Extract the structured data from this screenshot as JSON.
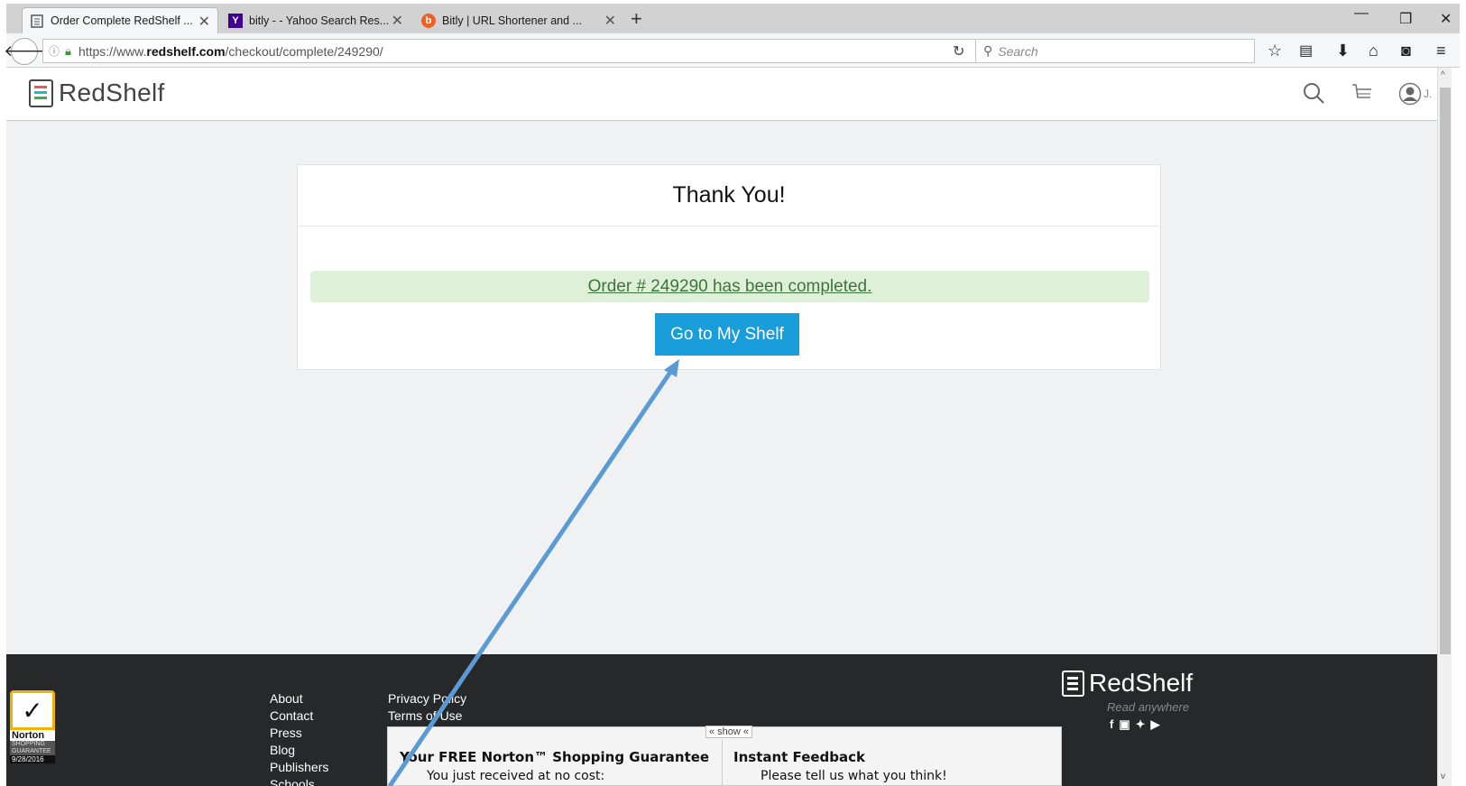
{
  "browser": {
    "tabs": [
      {
        "title": "Order Complete RedShelf ...",
        "icon": "page-icon"
      },
      {
        "title": "bitly - - Yahoo Search Res...",
        "icon": "yahoo-icon",
        "icon_text": "Y"
      },
      {
        "title": "Bitly | URL Shortener and ...",
        "icon": "bitly-icon",
        "icon_text": "b"
      }
    ],
    "url_prefix": "https://www.",
    "url_domain": "redshelf.com",
    "url_path": "/checkout/complete/249290/",
    "search_placeholder": "Search"
  },
  "header": {
    "logo_text": "RedShelf",
    "user_initial": "J."
  },
  "card": {
    "title": "Thank You!",
    "order_message": "Order # 249290 has been completed.",
    "button_label": "Go to My Shelf"
  },
  "footer": {
    "links_col1": [
      "About",
      "Contact",
      "Press",
      "Blog",
      "Publishers",
      "Schools"
    ],
    "links_col2": [
      "Privacy Policy",
      "Terms of Use"
    ],
    "logo_text": "RedShelf",
    "tagline": "Read anywhere",
    "social": "f in ❧ ▶"
  },
  "norton": {
    "brand": "Norton",
    "badge_text": "SHOPPING GUARANTEE",
    "date": "9/28/2016",
    "show_label": "« show «",
    "left_title": "Your FREE Norton™ Shopping Guarantee",
    "left_text": "You just received at no cost:",
    "right_title": "Instant Feedback",
    "right_text": "Please tell us what you think!"
  },
  "colors": {
    "primary_button": "#1a9ddb",
    "success_bg": "#dff0d8",
    "success_text": "#3c763d",
    "footer_bg": "#262829",
    "annotation_arrow": "#5b9bd5"
  }
}
